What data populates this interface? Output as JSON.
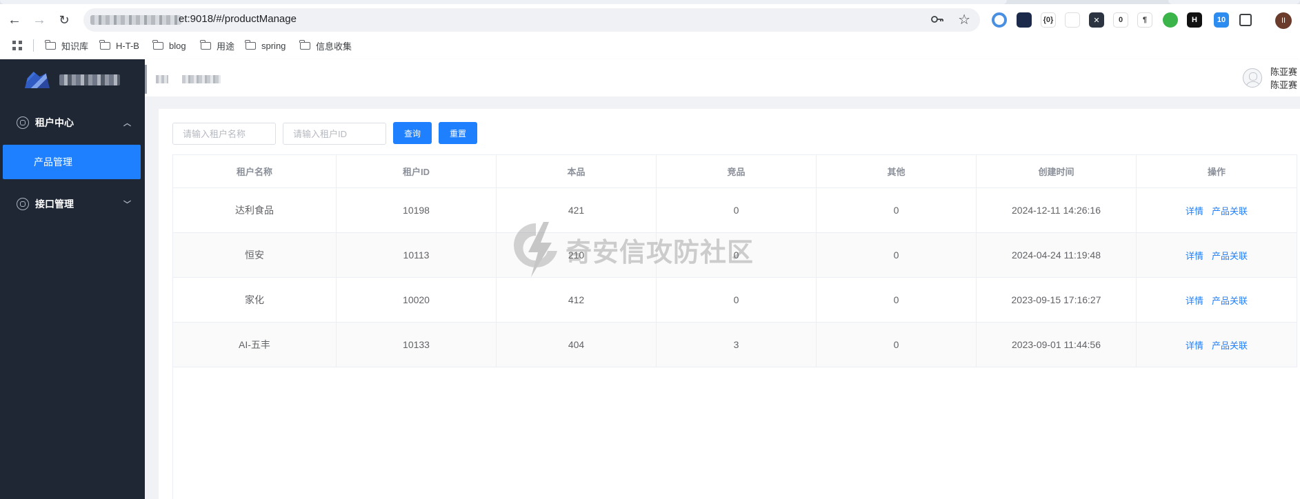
{
  "browser": {
    "url_suffix": "et:9018/#/productManage",
    "bookmarks": [
      "知识库",
      "H-T-B",
      "blog",
      "用途",
      "spring",
      "信息收集"
    ],
    "extensions": [
      {
        "name": "circle-ext-icon",
        "color": "#4a90e2",
        "text": ""
      },
      {
        "name": "hex-ext-icon",
        "color": "#1b2a4a",
        "text": ""
      },
      {
        "name": "json-ext-icon",
        "color": "#ffffff",
        "text": "{0}"
      },
      {
        "name": "unicorn-ext-icon",
        "color": "#ffffff",
        "text": ""
      },
      {
        "name": "x-ext-icon",
        "color": "#2b3440",
        "text": "✕"
      },
      {
        "name": "capture-ext-icon",
        "color": "#ffffff",
        "text": "0"
      },
      {
        "name": "pilcrow-ext-icon",
        "color": "#ffffff",
        "text": "¶"
      },
      {
        "name": "green-ext-icon",
        "color": "#3bb54a",
        "text": ""
      },
      {
        "name": "h-ext-icon",
        "color": "#111111",
        "text": "H"
      },
      {
        "name": "badge-ext-icon",
        "color": "#2d8cf0",
        "text": "10"
      },
      {
        "name": "puzzle-ext-icon",
        "color": "#ffffff",
        "text": ""
      }
    ],
    "profile_initial": "II"
  },
  "sidebar": {
    "groups": [
      {
        "label": "租户中心",
        "expanded": true,
        "items": [
          {
            "label": "产品管理",
            "active": true
          }
        ]
      },
      {
        "label": "接口管理",
        "expanded": false,
        "items": []
      }
    ]
  },
  "header": {
    "user_name_1": "陈亚赛",
    "user_name_2": "陈亚赛"
  },
  "search": {
    "tenant_name_placeholder": "请输入租户名称",
    "tenant_id_placeholder": "请输入租户ID",
    "query_label": "查询",
    "reset_label": "重置"
  },
  "table": {
    "columns": [
      "租户名称",
      "租户ID",
      "本品",
      "竞品",
      "其他",
      "创建时间",
      "操作"
    ],
    "rows": [
      {
        "name": "达利食品",
        "id": "10198",
        "own": "421",
        "competitor": "0",
        "other": "0",
        "created": "2024-12-11 14:26:16"
      },
      {
        "name": "恒安",
        "id": "10113",
        "own": "210",
        "competitor": "0",
        "other": "0",
        "created": "2024-04-24 11:19:48"
      },
      {
        "name": "家化",
        "id": "10020",
        "own": "412",
        "competitor": "0",
        "other": "0",
        "created": "2023-09-15 17:16:27"
      },
      {
        "name": "AI-五丰",
        "id": "10133",
        "own": "404",
        "competitor": "3",
        "other": "0",
        "created": "2023-09-01 11:44:56"
      }
    ],
    "op_detail": "详情",
    "op_link": "产品关联"
  },
  "watermark": {
    "text": "奇安信攻防社区"
  }
}
